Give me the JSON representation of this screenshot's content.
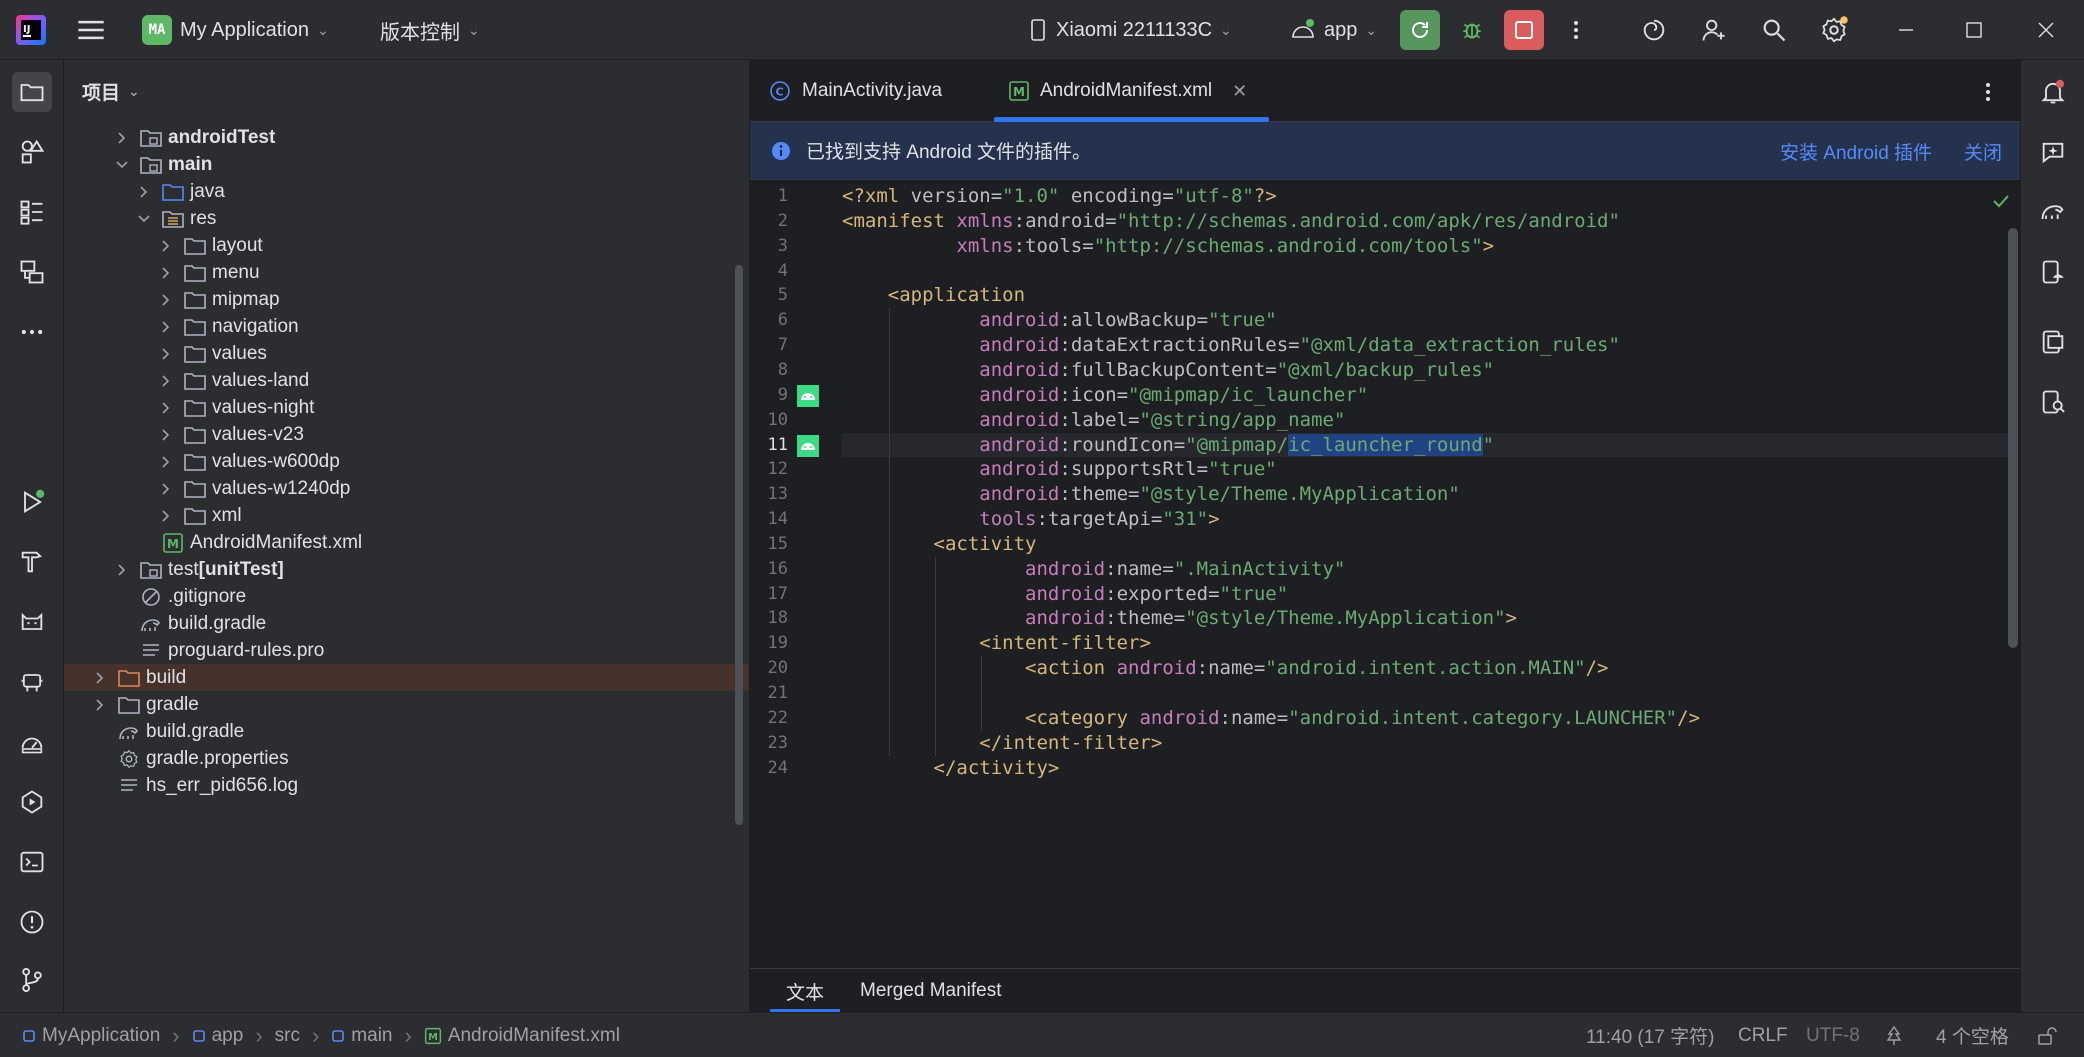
{
  "titlebar": {
    "project_badge": "MA",
    "project_name": "My Application",
    "vcs_label": "版本控制",
    "device": "Xiaomi 2211133C",
    "run_config": "app"
  },
  "project_panel": {
    "title": "项目",
    "tree": [
      {
        "label": "androidTest",
        "indent": 2,
        "kind": "module-folder",
        "expanded": false,
        "bold": true
      },
      {
        "label": "main",
        "indent": 2,
        "kind": "module-folder",
        "expanded": true,
        "bold": true
      },
      {
        "label": "java",
        "indent": 3,
        "kind": "blue-folder",
        "expanded": false
      },
      {
        "label": "res",
        "indent": 3,
        "kind": "res-folder",
        "expanded": true
      },
      {
        "label": "layout",
        "indent": 4,
        "kind": "folder",
        "expanded": false
      },
      {
        "label": "menu",
        "indent": 4,
        "kind": "folder",
        "expanded": false
      },
      {
        "label": "mipmap",
        "indent": 4,
        "kind": "folder",
        "expanded": false
      },
      {
        "label": "navigation",
        "indent": 4,
        "kind": "folder",
        "expanded": false
      },
      {
        "label": "values",
        "indent": 4,
        "kind": "folder",
        "expanded": false
      },
      {
        "label": "values-land",
        "indent": 4,
        "kind": "folder",
        "expanded": false
      },
      {
        "label": "values-night",
        "indent": 4,
        "kind": "folder",
        "expanded": false
      },
      {
        "label": "values-v23",
        "indent": 4,
        "kind": "folder",
        "expanded": false
      },
      {
        "label": "values-w600dp",
        "indent": 4,
        "kind": "folder",
        "expanded": false
      },
      {
        "label": "values-w1240dp",
        "indent": 4,
        "kind": "folder",
        "expanded": false
      },
      {
        "label": "xml",
        "indent": 4,
        "kind": "folder",
        "expanded": false
      },
      {
        "label": "AndroidManifest.xml",
        "indent": 3,
        "kind": "manifest",
        "leaf": true
      },
      {
        "label": "test",
        "suffix": " [unitTest]",
        "indent": 2,
        "kind": "module-folder",
        "expanded": false
      },
      {
        "label": ".gitignore",
        "indent": 2,
        "kind": "ignore",
        "leaf": true
      },
      {
        "label": "build.gradle",
        "indent": 2,
        "kind": "gradle",
        "leaf": true
      },
      {
        "label": "proguard-rules.pro",
        "indent": 2,
        "kind": "text",
        "leaf": true
      },
      {
        "label": "build",
        "indent": 1,
        "kind": "orange-folder",
        "expanded": false,
        "selected": true
      },
      {
        "label": "gradle",
        "indent": 1,
        "kind": "folder",
        "expanded": false
      },
      {
        "label": "build.gradle",
        "indent": 1,
        "kind": "gradle",
        "leaf": true
      },
      {
        "label": "gradle.properties",
        "indent": 1,
        "kind": "gear",
        "leaf": true
      },
      {
        "label": "hs_err_pid656.log",
        "indent": 1,
        "kind": "text",
        "leaf": true
      }
    ]
  },
  "editor": {
    "tabs": [
      {
        "label": "MainActivity.java",
        "active": false
      },
      {
        "label": "AndroidManifest.xml",
        "active": true
      }
    ],
    "banner": {
      "message": "已找到支持 Android 文件的插件。",
      "install_label": "安装 Android 插件",
      "close_label": "关闭"
    },
    "current_line": 11,
    "lines": [
      "<?xml version=\"1.0\" encoding=\"utf-8\"?>",
      "<manifest xmlns:android=\"http://schemas.android.com/apk/res/android\"",
      "          xmlns:tools=\"http://schemas.android.com/tools\">",
      "",
      "    <application",
      "            android:allowBackup=\"true\"",
      "            android:dataExtractionRules=\"@xml/data_extraction_rules\"",
      "            android:fullBackupContent=\"@xml/backup_rules\"",
      "            android:icon=\"@mipmap/ic_launcher\"",
      "            android:label=\"@string/app_name\"",
      "            android:roundIcon=\"@mipmap/ic_launcher_round\"",
      "            android:supportsRtl=\"true\"",
      "            android:theme=\"@style/Theme.MyApplication\"",
      "            tools:targetApi=\"31\">",
      "        <activity",
      "                android:name=\".MainActivity\"",
      "                android:exported=\"true\"",
      "                android:theme=\"@style/Theme.MyApplication\">",
      "            <intent-filter>",
      "                <action android:name=\"android.intent.action.MAIN\"/>",
      "",
      "                <category android:name=\"android.intent.category.LAUNCHER\"/>",
      "            </intent-filter>",
      "        </activity>"
    ],
    "selection": {
      "line": 11,
      "text": "ic_launcher_round"
    },
    "gutter_icon_lines": [
      9,
      11
    ],
    "bottom_tabs": [
      {
        "label": "文本",
        "active": true
      },
      {
        "label": "Merged Manifest",
        "active": false
      }
    ]
  },
  "statusbar": {
    "breadcrumbs": [
      "MyApplication",
      "app",
      "src",
      "main",
      "AndroidManifest.xml"
    ],
    "position": "11:40 (17 字符)",
    "line_ending": "CRLF",
    "encoding": "UTF-8",
    "indent": "4 个空格"
  },
  "colors": {
    "accent": "#3574f0",
    "run_green": "#57965c",
    "stop_red": "#db5c5c",
    "folder": "#aeb3c2",
    "android_green": "#5fb865"
  }
}
